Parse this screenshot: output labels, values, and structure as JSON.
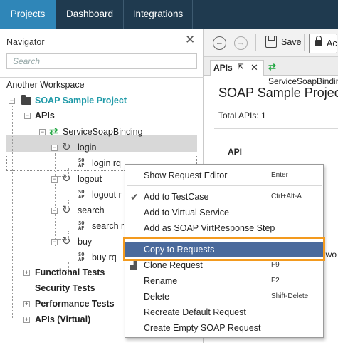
{
  "top_tabs": [
    {
      "label": "Projects"
    },
    {
      "label": "Dashboard"
    },
    {
      "label": "Integrations"
    }
  ],
  "navigator": {
    "title": "Navigator",
    "search_placeholder": "Search",
    "workspace": "Another Workspace",
    "project": "SOAP Sample Project",
    "apis": "APIs",
    "binding": "ServiceSoapBinding",
    "operations": [
      {
        "name": "login",
        "request": "login rq"
      },
      {
        "name": "logout",
        "request": "logout r"
      },
      {
        "name": "search",
        "request": "search r"
      },
      {
        "name": "buy",
        "request": "buy rq"
      }
    ],
    "functional_tests": "Functional Tests",
    "security_tests": "Security Tests",
    "performance_tests": "Performance Tests",
    "apis_virtual": "APIs (Virtual)",
    "soap_badge_top": "SO",
    "soap_badge_bottom": "AP"
  },
  "toolbar": {
    "save_label": "Save",
    "cut_label": "Ac"
  },
  "doc_tabs": {
    "active": "APIs",
    "inactive": "ServiceSoapBinding"
  },
  "content": {
    "title": "SOAP Sample Projec",
    "total_apis": "Total APIs: 1",
    "api_header": "API",
    "fragment": "t wo"
  },
  "context_menu": {
    "items": [
      {
        "label": "Show Request Editor",
        "shortcut": "Enter"
      },
      {
        "label": "Add to TestCase",
        "shortcut": "Ctrl+Alt-A"
      },
      {
        "label": "Add to Virtual Service",
        "shortcut": ""
      },
      {
        "label": "Add as SOAP VirtResponse Step",
        "shortcut": ""
      },
      {
        "label": "Copy to Requests",
        "shortcut": ""
      },
      {
        "label": "Clone Request",
        "shortcut": "F9"
      },
      {
        "label": "Rename",
        "shortcut": "F2"
      },
      {
        "label": "Delete",
        "shortcut": "Shift-Delete"
      },
      {
        "label": "Recreate Default Request",
        "shortcut": ""
      },
      {
        "label": "Create Empty SOAP Request",
        "shortcut": ""
      }
    ],
    "highlighted": "Copy to Requests"
  },
  "colors": {
    "topbar": "#1f3a4f",
    "active_tab": "#2f86b8",
    "menu_highlight": "#4a6a9c",
    "annotation_frame": "#f39a1e",
    "binding_icon": "#1fa640",
    "project_text": "#1f9aa8"
  }
}
